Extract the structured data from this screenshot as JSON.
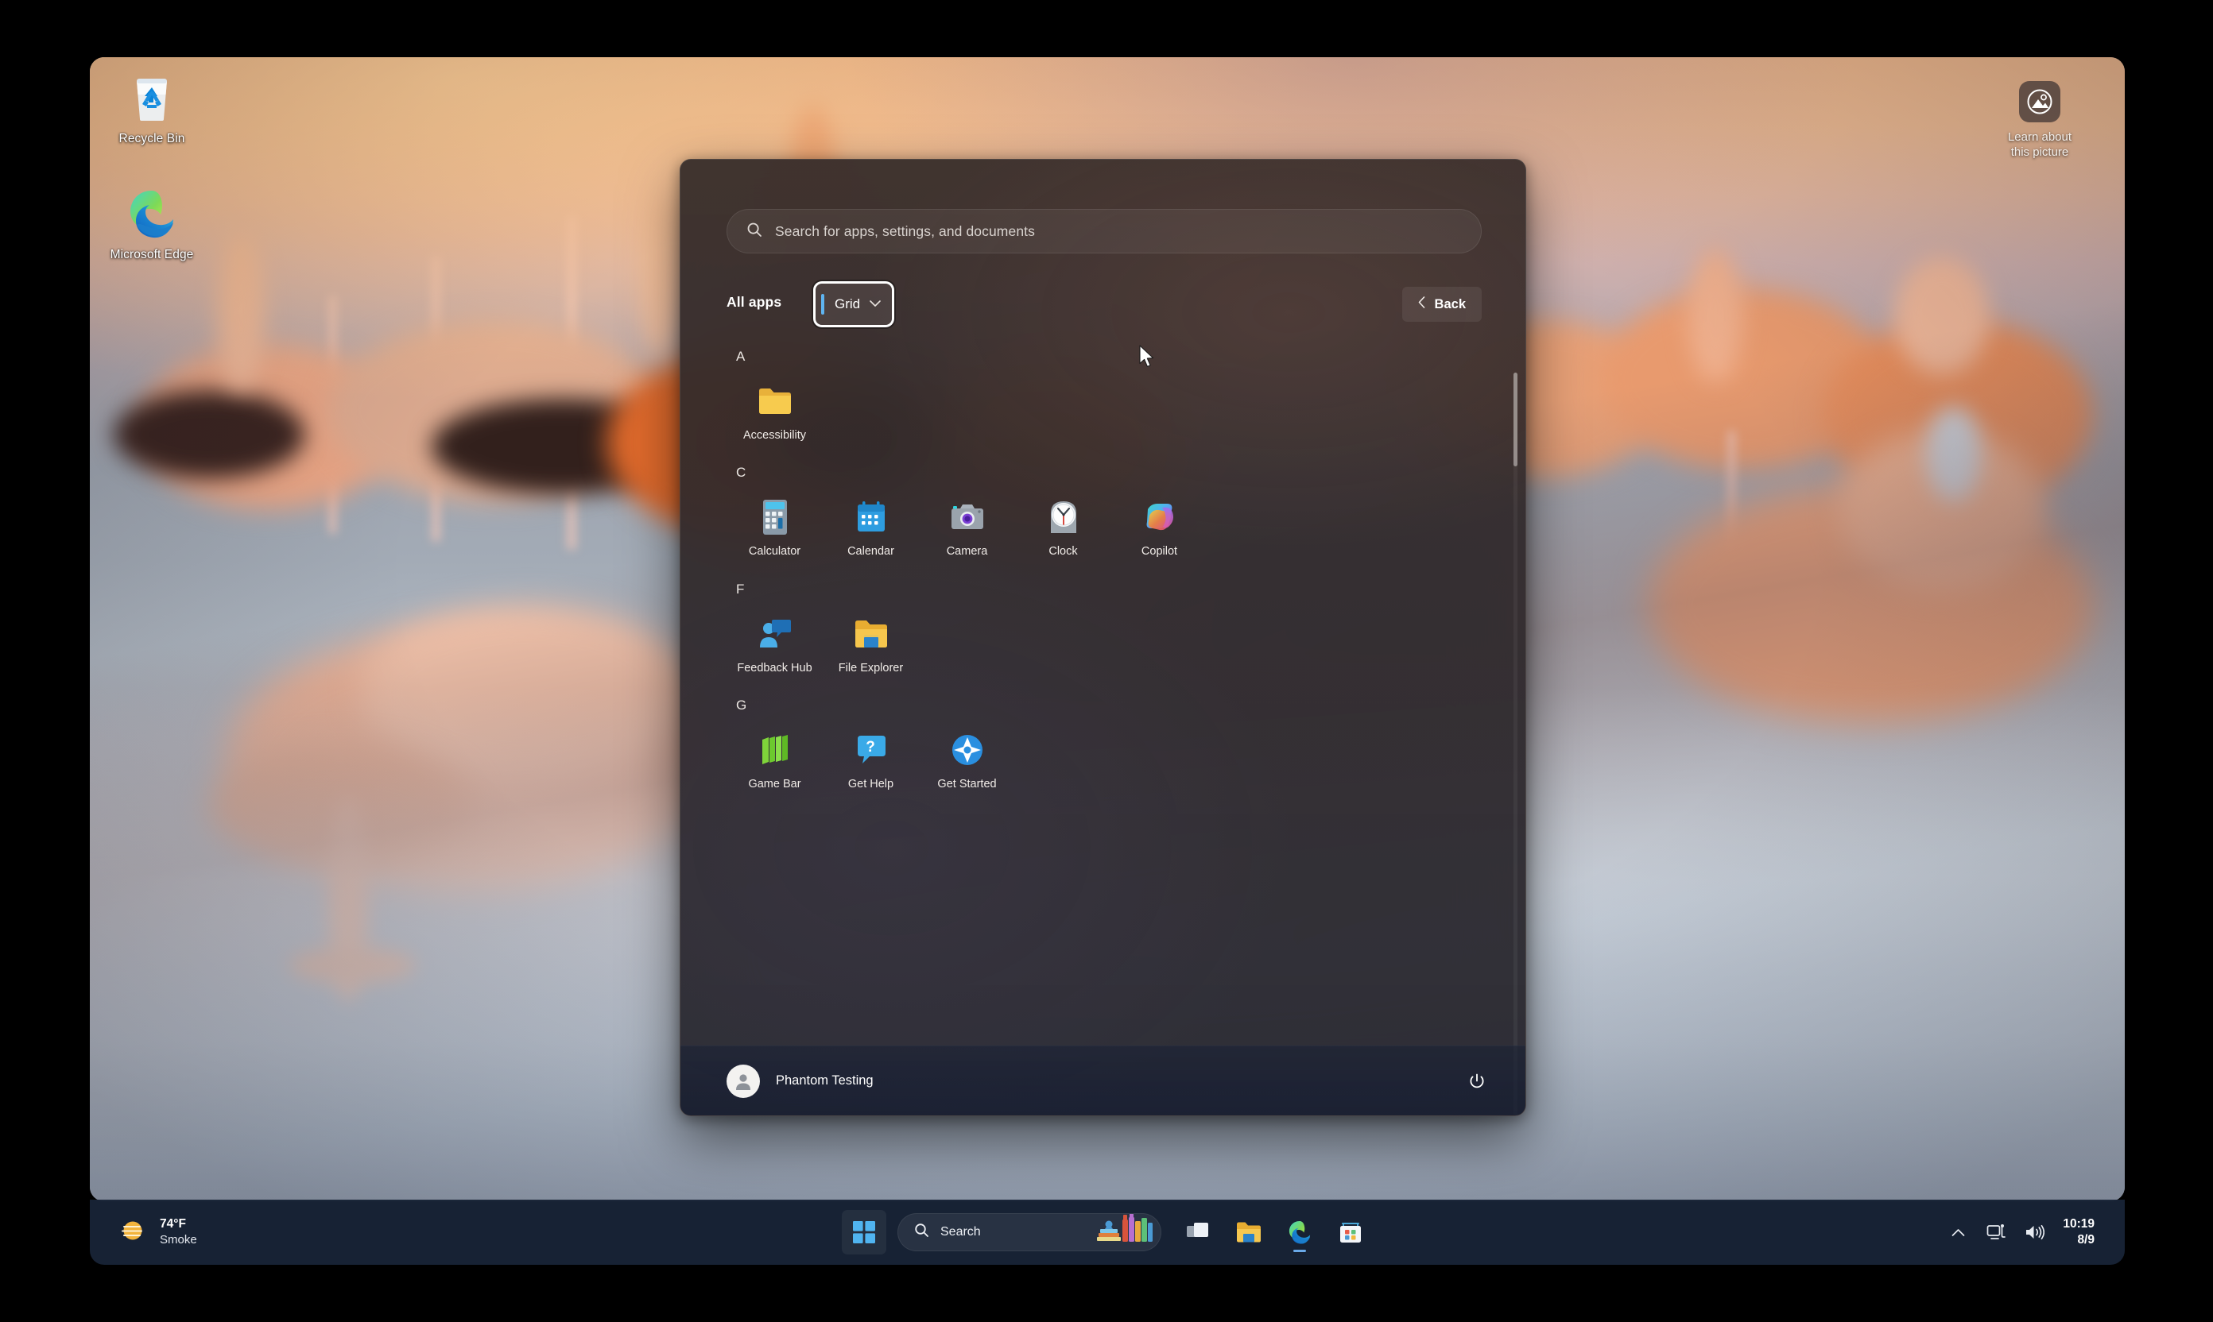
{
  "desktop": {
    "icons": [
      {
        "label": "Recycle Bin",
        "icon": "recycle-bin-icon"
      },
      {
        "label": "Microsoft Edge",
        "icon": "edge-icon"
      }
    ],
    "learn_about_picture": {
      "line1": "Learn about",
      "line2": "this picture",
      "icon": "picture-info-icon"
    }
  },
  "start_menu": {
    "search": {
      "placeholder": "Search for apps, settings, and documents",
      "icon": "search-icon"
    },
    "header": {
      "all_apps_label": "All apps",
      "view_selector": {
        "value": "Grid",
        "icon": "chevron-down-icon"
      },
      "back_label": "Back",
      "back_icon": "chevron-left-icon"
    },
    "sections": [
      {
        "letter": "A",
        "apps": [
          {
            "name": "Accessibility",
            "icon": "folder-icon"
          }
        ]
      },
      {
        "letter": "C",
        "apps": [
          {
            "name": "Calculator",
            "icon": "calculator-icon"
          },
          {
            "name": "Calendar",
            "icon": "calendar-icon"
          },
          {
            "name": "Camera",
            "icon": "camera-icon"
          },
          {
            "name": "Clock",
            "icon": "clock-icon"
          },
          {
            "name": "Copilot",
            "icon": "copilot-icon"
          }
        ]
      },
      {
        "letter": "F",
        "apps": [
          {
            "name": "Feedback Hub",
            "icon": "feedback-hub-icon"
          },
          {
            "name": "File Explorer",
            "icon": "file-explorer-icon"
          }
        ]
      },
      {
        "letter": "G",
        "apps": [
          {
            "name": "Game Bar",
            "icon": "game-bar-icon"
          },
          {
            "name": "Get Help",
            "icon": "get-help-icon"
          },
          {
            "name": "Get Started",
            "icon": "get-started-icon"
          }
        ]
      }
    ],
    "footer": {
      "user_name": "Phantom Testing",
      "avatar_icon": "user-avatar-icon",
      "power_icon": "power-icon"
    }
  },
  "taskbar": {
    "weather": {
      "temperature": "74°F",
      "condition": "Smoke",
      "icon": "smoke-sun-icon"
    },
    "start_button": {
      "icon": "windows-logo-icon"
    },
    "search": {
      "label": "Search",
      "icon": "search-icon",
      "decoration_icon": "books-illustration"
    },
    "pinned": [
      {
        "name": "Task View",
        "icon": "task-view-icon"
      },
      {
        "name": "File Explorer",
        "icon": "file-explorer-icon"
      },
      {
        "name": "Microsoft Edge",
        "icon": "edge-icon"
      },
      {
        "name": "Microsoft Store",
        "icon": "microsoft-store-icon"
      }
    ],
    "tray": {
      "overflow_icon": "chevron-up-icon",
      "network_icon": "network-icon",
      "volume_icon": "volume-icon",
      "time": "10:19",
      "date": "8/9"
    }
  },
  "colors": {
    "accent": "#5fb4f0",
    "taskbar_bg": "#192538",
    "start_bg": "#302928"
  }
}
